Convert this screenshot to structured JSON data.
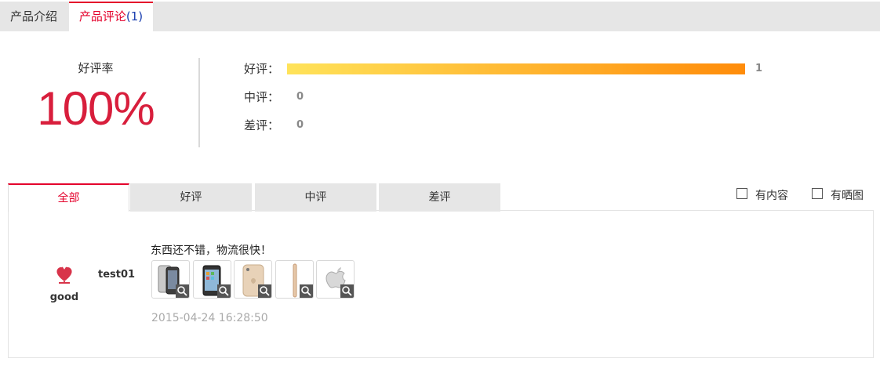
{
  "top_tabs": {
    "intro_label": "产品介绍",
    "reviews_label": "产品评论",
    "reviews_count": "(1)"
  },
  "summary": {
    "rate_label": "好评率",
    "rate_value": "100%",
    "good_label": "好评：",
    "good_count": "1",
    "good_fraction": 1.0,
    "mid_label": "中评：",
    "mid_count": "0",
    "bad_label": "差评：",
    "bad_count": "0"
  },
  "filter_tabs": [
    "全部",
    "好评",
    "中评",
    "差评"
  ],
  "filters": {
    "has_content": "有内容",
    "has_photos": "有晒图"
  },
  "review": {
    "badge": "good",
    "username": "test01",
    "comment": "东西还不错，物流很快！",
    "date": "2015-04-24 16:28:50",
    "thumbnails": [
      "iphone-gray-thumb",
      "iphone-dark-thumb",
      "iphone-gold-thumb",
      "iphone-side-thumb",
      "apple-logo-thumb"
    ]
  },
  "colors": {
    "accent": "#e4002b",
    "rate": "#d81e3c",
    "bar_start": "#ffe35a",
    "bar_end": "#ff8c0a"
  }
}
